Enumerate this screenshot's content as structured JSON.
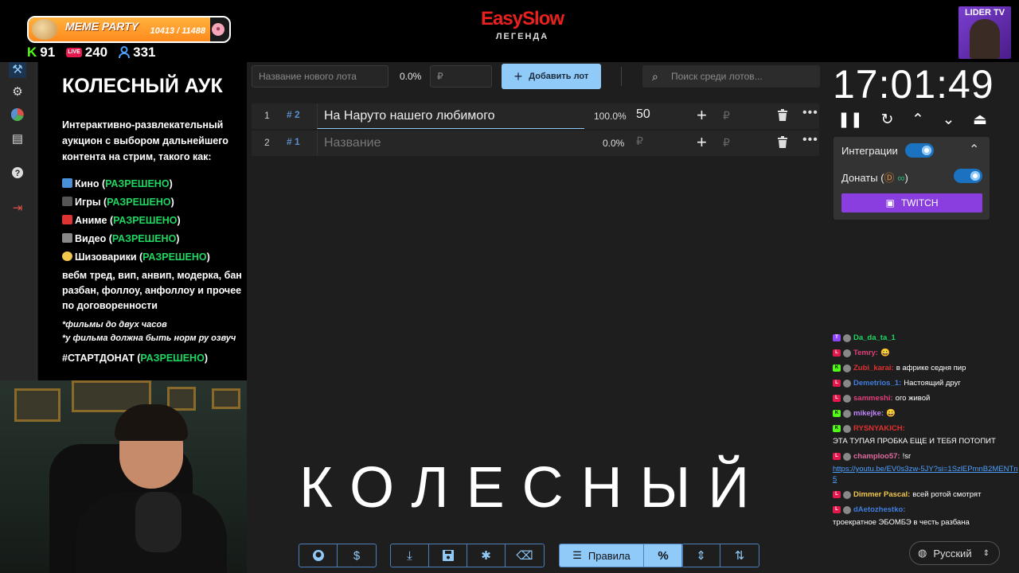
{
  "overlay": {
    "meme_title": "MEME PARTY",
    "meme_count": "10413 / 11488",
    "meme_fraction": 0.906,
    "kick_viewers": "91",
    "live_viewers": "240",
    "total_viewers": "331",
    "stream_logo": "EasySlow",
    "stream_logo_sub": "ЛЕГЕНДА",
    "lider_label": "LIDER TV"
  },
  "rules": {
    "title": "КОЛЕСНЫЙ АУК",
    "description": "Интерактивно-развлекательный аукцион с выбором дальнейшего контента на стрим, такого как:",
    "items": [
      {
        "label": "Кино",
        "status": "РАЗРЕШЕНО"
      },
      {
        "label": "Игры",
        "status": "РАЗРЕШЕНО"
      },
      {
        "label": "Аниме",
        "status": "РАЗРЕШЕНО"
      },
      {
        "label": "Видео",
        "status": "РАЗРЕШЕНО"
      },
      {
        "label": "Шизоварики",
        "status": "РАЗРЕШЕНО"
      }
    ],
    "extra": "вебм тред, вип, анвип, модерка, бан разбан, фоллоу, анфоллоу и прочее по договоренности",
    "note1": "*фильмы до двух часов",
    "note2": "*у фильма должна быть норм ру озвуч",
    "final_label": "#СТАРТДОНАТ",
    "final_status": "РАЗРЕШЕНО"
  },
  "auction": {
    "new_lot_placeholder": "Название нового лота",
    "new_lot_percent": "0.0%",
    "new_lot_amount_placeholder": "₽",
    "add_button": "Добавить лот",
    "search_placeholder": "Поиск среди лотов...",
    "lots": [
      {
        "n": "1",
        "id": "# 2",
        "title": "На Наруто нашего любимого",
        "percent": "100.0%",
        "amount": "50",
        "currency": "₽"
      },
      {
        "n": "2",
        "id": "# 1",
        "title": "Название",
        "percent": "0.0%",
        "amount": "₽",
        "currency": "₽"
      }
    ],
    "big_text": "КОЛЕСНЫЙ",
    "rules_button": "Правила",
    "percent_button": "%"
  },
  "timer": {
    "time": "17:01:49"
  },
  "integrations": {
    "label": "Интеграции",
    "donations_label": "Донаты (",
    "donations_label_end": ")",
    "twitch_button": "TWITCH",
    "integrations_on": true,
    "donations_on": true
  },
  "chat": [
    {
      "platform": "twitch",
      "user": "Da_da_ta_1",
      "color": "#1ed760",
      "text": ""
    },
    {
      "platform": "live",
      "user": "Temry:",
      "color": "#e0407a",
      "text": "😀"
    },
    {
      "platform": "kick",
      "user": "Zubi_karai:",
      "color": "#e03030",
      "text": "в африке седня пир"
    },
    {
      "platform": "live",
      "user": "Demetrios_1:",
      "color": "#3f7ee0",
      "text": "Настоящий друг"
    },
    {
      "platform": "live",
      "user": "sammeshi:",
      "color": "#e0407a",
      "text": "ого живой"
    },
    {
      "platform": "kick",
      "user": "mikejke:",
      "color": "#c084fc",
      "text": "😀"
    },
    {
      "platform": "kick",
      "user": "RYSNYAKICH:",
      "color": "#e03030",
      "text": "ЭТА ТУПАЯ ПРОБКА ЕЩЕ И ТЕБЯ ПОТОПИТ"
    },
    {
      "platform": "live",
      "user": "champloo57:",
      "color": "#e06aa0",
      "text": "!sr",
      "link": "https://youtu.be/EV0s3zw-5JY?si=1SzlEPmnB2MENTn5"
    },
    {
      "platform": "live",
      "user": "Dimmer Pascal:",
      "color": "#f2c94c",
      "text": "всей ротой смотрят"
    },
    {
      "platform": "live",
      "user": "dAetozhestko:",
      "color": "#3f7ee0",
      "text": "троекратное ЭБОМБЭ в честь разбана"
    }
  ],
  "language": "Русский",
  "colors": {
    "accent": "#90caf9",
    "allowed": "#1ed760",
    "twitch": "#8a3ee0",
    "logo": "#e8211e"
  }
}
